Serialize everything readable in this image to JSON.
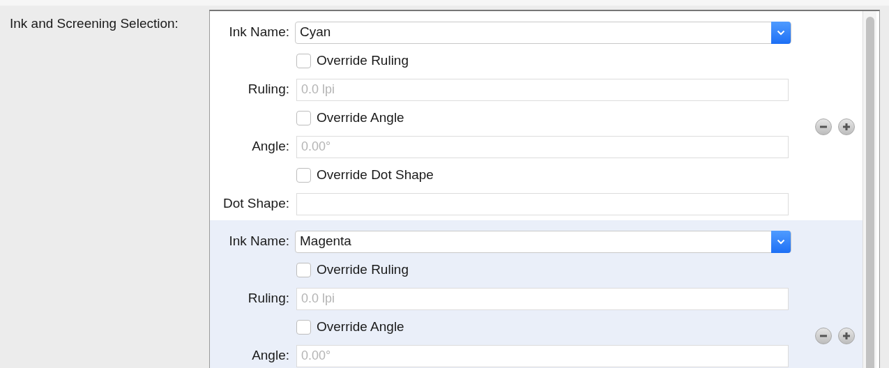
{
  "section_label": "Ink and Screening Selection:",
  "entries": [
    {
      "selected": false,
      "rows": [
        {
          "kind": "select",
          "label": "Ink Name:",
          "value": "Cyan"
        },
        {
          "kind": "checkbox",
          "label": "Override Ruling",
          "checked": false
        },
        {
          "kind": "field",
          "label": "Ruling:",
          "placeholder": "0.0 lpi"
        },
        {
          "kind": "checkbox",
          "label": "Override Angle",
          "checked": false
        },
        {
          "kind": "field",
          "label": "Angle:",
          "placeholder": "0.00°"
        },
        {
          "kind": "checkbox",
          "label": "Override Dot Shape",
          "checked": false
        },
        {
          "kind": "field",
          "label": "Dot Shape:"
        }
      ]
    },
    {
      "selected": true,
      "rows": [
        {
          "kind": "select",
          "label": "Ink Name:",
          "value": "Magenta"
        },
        {
          "kind": "checkbox",
          "label": "Override Ruling",
          "checked": false
        },
        {
          "kind": "field",
          "label": "Ruling:",
          "placeholder": "0.0 lpi"
        },
        {
          "kind": "checkbox",
          "label": "Override Angle",
          "checked": false
        },
        {
          "kind": "field",
          "label": "Angle:",
          "placeholder": "0.00°"
        }
      ]
    }
  ]
}
